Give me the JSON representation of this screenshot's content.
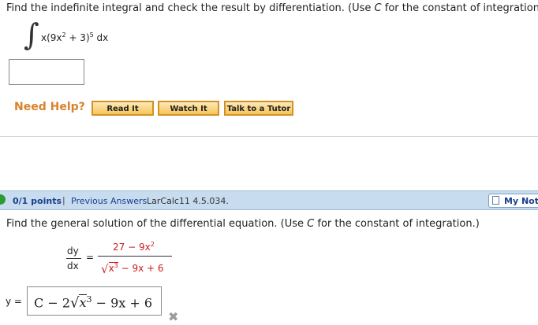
{
  "question1": {
    "instruction_prefix": "Find the indefinite integral and check the result by differentiation. (Use ",
    "instruction_var": "C",
    "instruction_suffix": " for the constant of integration.)",
    "integrand_a": "x(9x",
    "integrand_exp1": "2",
    "integrand_b": " + 3)",
    "integrand_exp2": "5",
    "integrand_c": " dx",
    "answer_value": ""
  },
  "help": {
    "label": "Need Help?",
    "buttons": [
      "Read It",
      "Watch It",
      "Talk to a Tutor"
    ]
  },
  "question2": {
    "points": "0/1 points",
    "separator": "|",
    "previous_answers": "Previous Answers",
    "code": "LarCalc11 4.5.034.",
    "my_notes": "My Notes",
    "instruction_prefix": "Find the general solution of the differential equation. (Use ",
    "instruction_var": "C",
    "instruction_suffix": " for the constant of integration.)",
    "dy": "dy",
    "dx": "dx",
    "equals": "=",
    "numerator_a": "27 − 9x",
    "numerator_exp": "2",
    "denominator_a": "x",
    "denominator_exp": "3",
    "denominator_b": " − 9x + 6",
    "y_label": "y =",
    "answer_a": "C − 2",
    "answer_x": "x",
    "answer_exp": "3",
    "answer_b": " − 9x + 6",
    "status_icon": "x-mark-icon",
    "status_mark": "✖"
  },
  "colors": {
    "need_help": "#d9822b",
    "bar_bg": "#c8dcf0",
    "link": "#1a3e8a",
    "red_math": "#c81e1e",
    "incorrect": "#9a9a9a"
  }
}
